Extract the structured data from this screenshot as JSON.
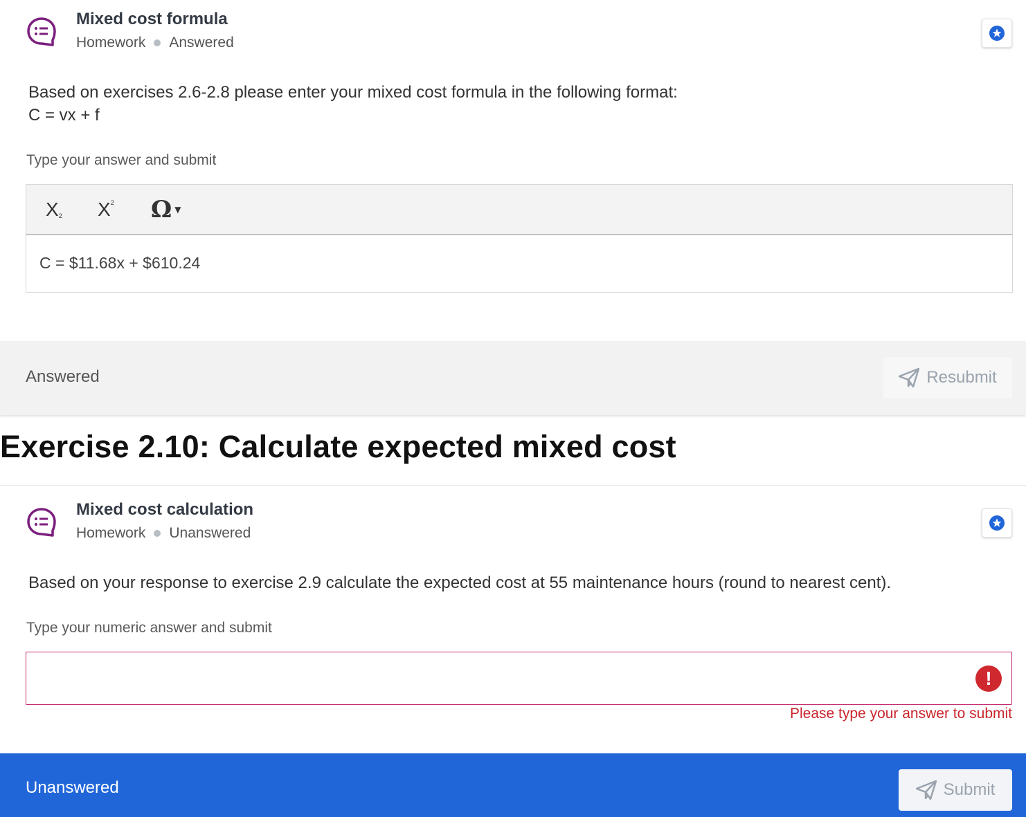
{
  "question1": {
    "title": "Mixed cost formula",
    "type": "Homework",
    "status": "Answered",
    "icon": "chat-list-icon",
    "prompt_line1": "Based on exercises 2.6-2.8 please enter your mixed cost formula in the following format:",
    "prompt_line2": "C = vx + f",
    "hint": "Type your answer and submit",
    "toolbar": {
      "subscript_label": "X",
      "subscript_mark": "2",
      "superscript_label": "X",
      "superscript_mark": "2",
      "symbol_label": "Ω"
    },
    "answer": "C = $11.68x + $610.24",
    "footer_status": "Answered",
    "action_label": "Resubmit"
  },
  "section_heading": "Exercise 2.10: Calculate expected mixed cost",
  "question2": {
    "title": "Mixed cost calculation",
    "type": "Homework",
    "status": "Unanswered",
    "icon": "chat-list-icon",
    "prompt": "Based on your response to exercise 2.9 calculate the expected cost at 55 maintenance hours (round to nearest cent).",
    "hint": "Type your numeric answer and submit",
    "input_value": "",
    "error_message": "Please type your answer to submit",
    "footer_status": "Unanswered",
    "action_label": "Submit"
  },
  "colors": {
    "icon_purple": "#7b1f7e",
    "star_blue": "#2166d9",
    "error_red": "#d0282f",
    "footer_blue": "#2166d9"
  }
}
